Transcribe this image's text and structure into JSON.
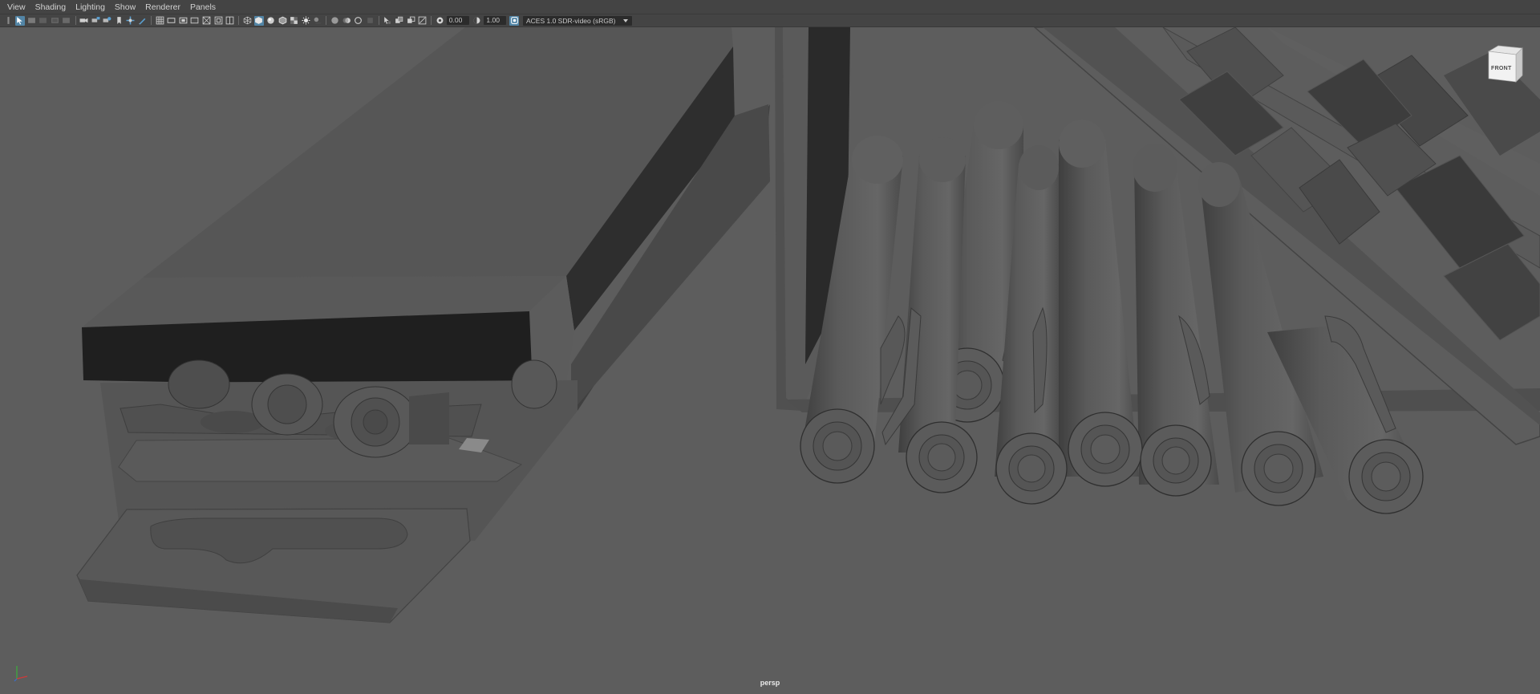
{
  "menu": {
    "items": [
      "View",
      "Shading",
      "Lighting",
      "Show",
      "Renderer",
      "Panels"
    ]
  },
  "toolbar": {
    "exposure_value": "0.00",
    "gamma_value": "1.00",
    "color_space": "ACES 1.0 SDR-video (sRGB)",
    "active_tool": "select-tool",
    "accent_color": "#5285a6"
  },
  "viewport": {
    "camera_label": "persp",
    "background_color": "#5d5d5d",
    "view_cube_face": "FRONT",
    "axis_colors": {
      "x": "#d03a3a",
      "y": "#3ab03a",
      "z": "#3a6fd0"
    }
  }
}
